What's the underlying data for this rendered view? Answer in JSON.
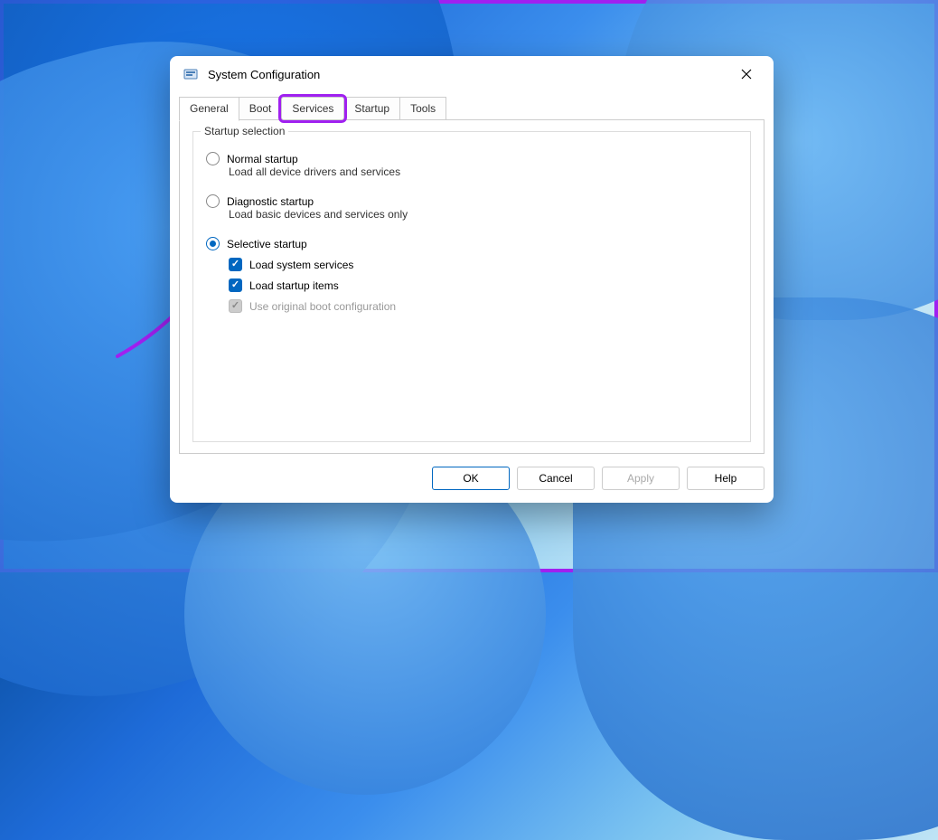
{
  "window": {
    "title": "System Configuration"
  },
  "tabs": [
    {
      "label": "General",
      "active": true
    },
    {
      "label": "Boot",
      "active": false
    },
    {
      "label": "Services",
      "active": false,
      "highlighted": true
    },
    {
      "label": "Startup",
      "active": false
    },
    {
      "label": "Tools",
      "active": false
    }
  ],
  "group": {
    "title": "Startup selection",
    "options": [
      {
        "label": "Normal startup",
        "sub": "Load all device drivers and services",
        "checked": false
      },
      {
        "label": "Diagnostic startup",
        "sub": "Load basic devices and services only",
        "checked": false
      },
      {
        "label": "Selective startup",
        "checked": true,
        "checks": [
          {
            "label": "Load system services",
            "checked": true,
            "disabled": false
          },
          {
            "label": "Load startup items",
            "checked": true,
            "disabled": false
          },
          {
            "label": "Use original boot configuration",
            "checked": true,
            "disabled": true
          }
        ]
      }
    ]
  },
  "buttons": {
    "ok": "OK",
    "cancel": "Cancel",
    "apply": "Apply",
    "help": "Help"
  },
  "colors": {
    "accent": "#0067c0",
    "highlight": "#a020f0"
  }
}
